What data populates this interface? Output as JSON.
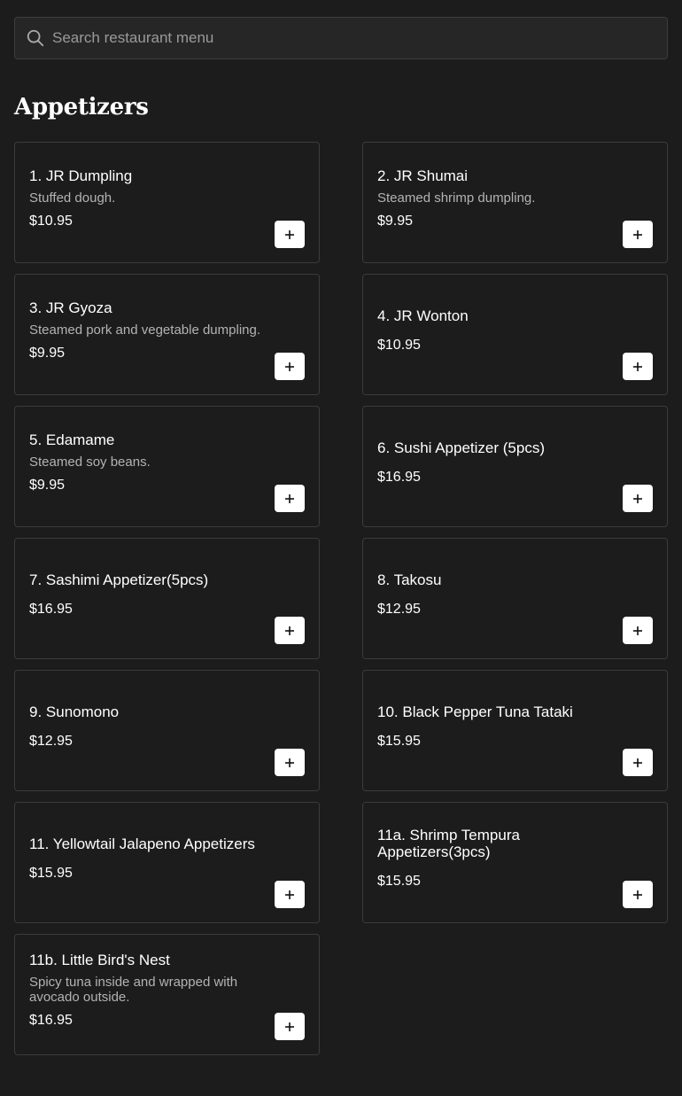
{
  "search": {
    "placeholder": "Search restaurant menu",
    "icon": "search-icon"
  },
  "section": {
    "title": "Appetizers"
  },
  "items": [
    {
      "name": "1. JR Dumpling",
      "description": "Stuffed dough.",
      "price": "$10.95"
    },
    {
      "name": "2. JR Shumai",
      "description": "Steamed shrimp dumpling.",
      "price": "$9.95"
    },
    {
      "name": "3. JR Gyoza",
      "description": "Steamed pork and vegetable dumpling.",
      "price": "$9.95"
    },
    {
      "name": "4. JR Wonton",
      "description": "",
      "price": "$10.95"
    },
    {
      "name": "5. Edamame",
      "description": "Steamed soy beans.",
      "price": "$9.95"
    },
    {
      "name": "6. Sushi Appetizer (5pcs)",
      "description": "",
      "price": "$16.95"
    },
    {
      "name": "7. Sashimi Appetizer(5pcs)",
      "description": "",
      "price": "$16.95"
    },
    {
      "name": "8. Takosu",
      "description": "",
      "price": "$12.95"
    },
    {
      "name": "9. Sunomono",
      "description": "",
      "price": "$12.95"
    },
    {
      "name": "10. Black Pepper Tuna Tataki",
      "description": "",
      "price": "$15.95"
    },
    {
      "name": "11. Yellowtail Jalapeno Appetizers",
      "description": "",
      "price": "$15.95"
    },
    {
      "name": "11a. Shrimp Tempura Appetizers(3pcs)",
      "description": "",
      "price": "$15.95"
    },
    {
      "name": "11b. Little Bird's Nest",
      "description": "Spicy tuna inside and wrapped with avocado outside.",
      "price": "$16.95"
    }
  ],
  "colors": {
    "background": "#1c1c1c",
    "card_border": "#3b3b3b",
    "add_button": "#ffffff"
  }
}
